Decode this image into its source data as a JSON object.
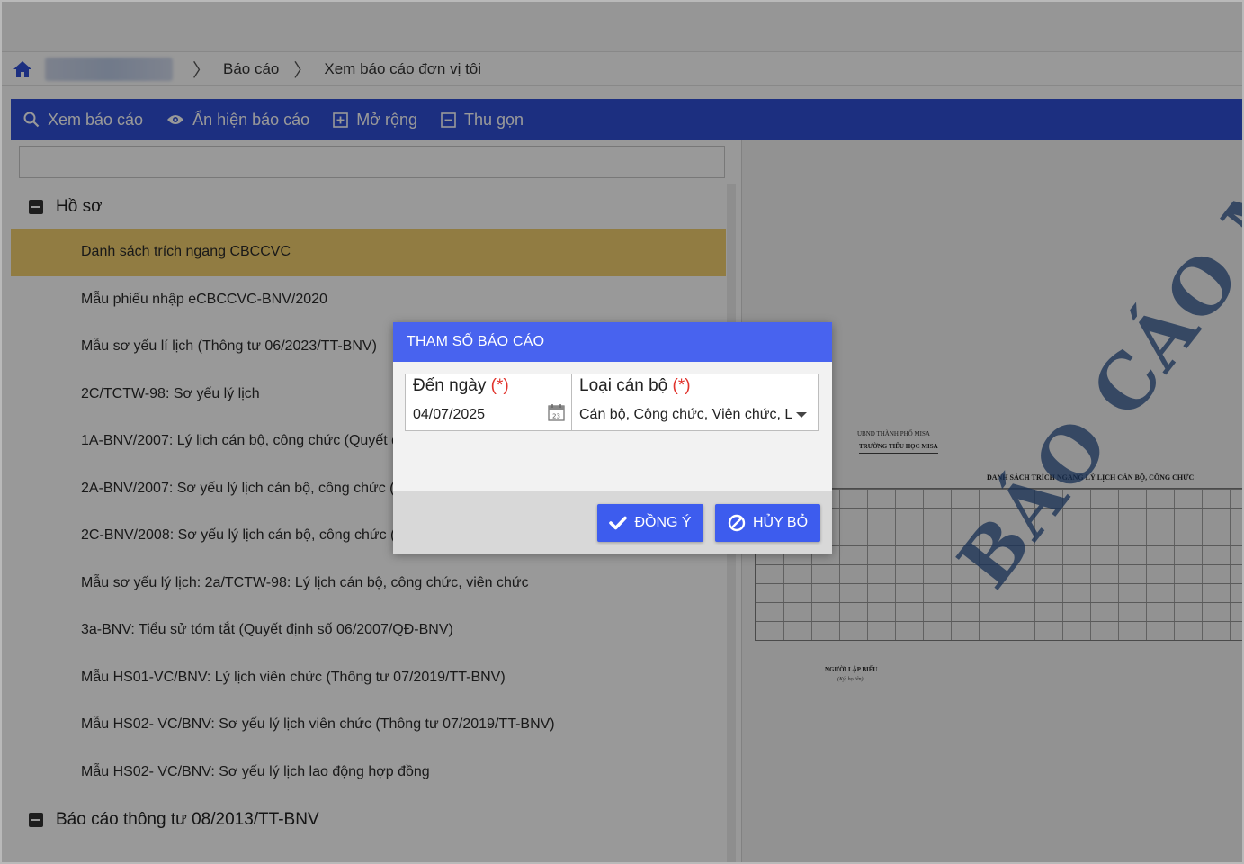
{
  "breadcrumb": {
    "items": [
      "Báo cáo",
      "Xem báo cáo đơn vị tôi"
    ]
  },
  "toolbar": {
    "view_label": "Xem báo cáo",
    "toggle_label": "Ẩn hiện báo cáo",
    "expand_label": "Mở rộng",
    "collapse_label": "Thu gọn"
  },
  "search": {
    "value": ""
  },
  "report_tree": {
    "groups": [
      {
        "label": "Hồ sơ",
        "items": [
          "Danh sách trích ngang CBCCVC",
          "Mẫu phiếu nhập eCBCCVC-BNV/2020",
          "Mẫu sơ yếu lí lịch (Thông tư 06/2023/TT-BNV)",
          "2C/TCTW-98: Sơ yếu lý lịch",
          "1A-BNV/2007: Lý lịch cán bộ, công chức (Quyết đ",
          "2A-BNV/2007: Sơ yếu lý lịch cán bộ, công chức (",
          "2C-BNV/2008: Sơ yếu lý lịch cán bộ, công chức (",
          "Mẫu sơ yếu lý lịch: 2a/TCTW-98: Lý lịch cán bộ, công chức, viên chức",
          "3a-BNV: Tiểu sử tóm tắt (Quyết định số 06/2007/QĐ-BNV)",
          "Mẫu HS01-VC/BNV: Lý lịch viên chức (Thông tư 07/2019/TT-BNV)",
          "Mẫu HS02- VC/BNV: Sơ yếu lý lịch viên chức (Thông tư 07/2019/TT-BNV)",
          "Mẫu HS02- VC/BNV: Sơ yếu lý lịch lao động hợp đồng"
        ],
        "selected_index": 0
      },
      {
        "label": "Báo cáo thông tư 08/2013/TT-BNV"
      }
    ]
  },
  "preview": {
    "org_line1": "UBND THÀNH PHỐ MISA",
    "org_line2": "TRƯỜNG TIỂU HỌC MISA",
    "title": "DANH SÁCH TRÍCH NGANG LÝ LỊCH CÁN BỘ, CÔNG CHỨC",
    "signer": "NGƯỜI LẬP BIỂU",
    "signer_note": "(Ký, họ tên)",
    "watermark": "BÁO CÁO MẪU"
  },
  "dialog": {
    "title": "THAM SỐ BÁO CÁO",
    "date_label": "Đến ngày",
    "type_label": "Loại cán bộ",
    "required_mark": "(*)",
    "date_value": "04/07/2025",
    "type_value": "Cán bộ, Công chức, Viên chức, Lao động hợp đồng",
    "ok_label": "ĐỒNG Ý",
    "cancel_label": "HỦY BỎ"
  },
  "colors": {
    "toolbar": "#2f4fd6",
    "dialog_header": "#4863ef",
    "button": "#3d5cee",
    "selected_row": "#f2cf6e",
    "required": "#e1342d"
  }
}
